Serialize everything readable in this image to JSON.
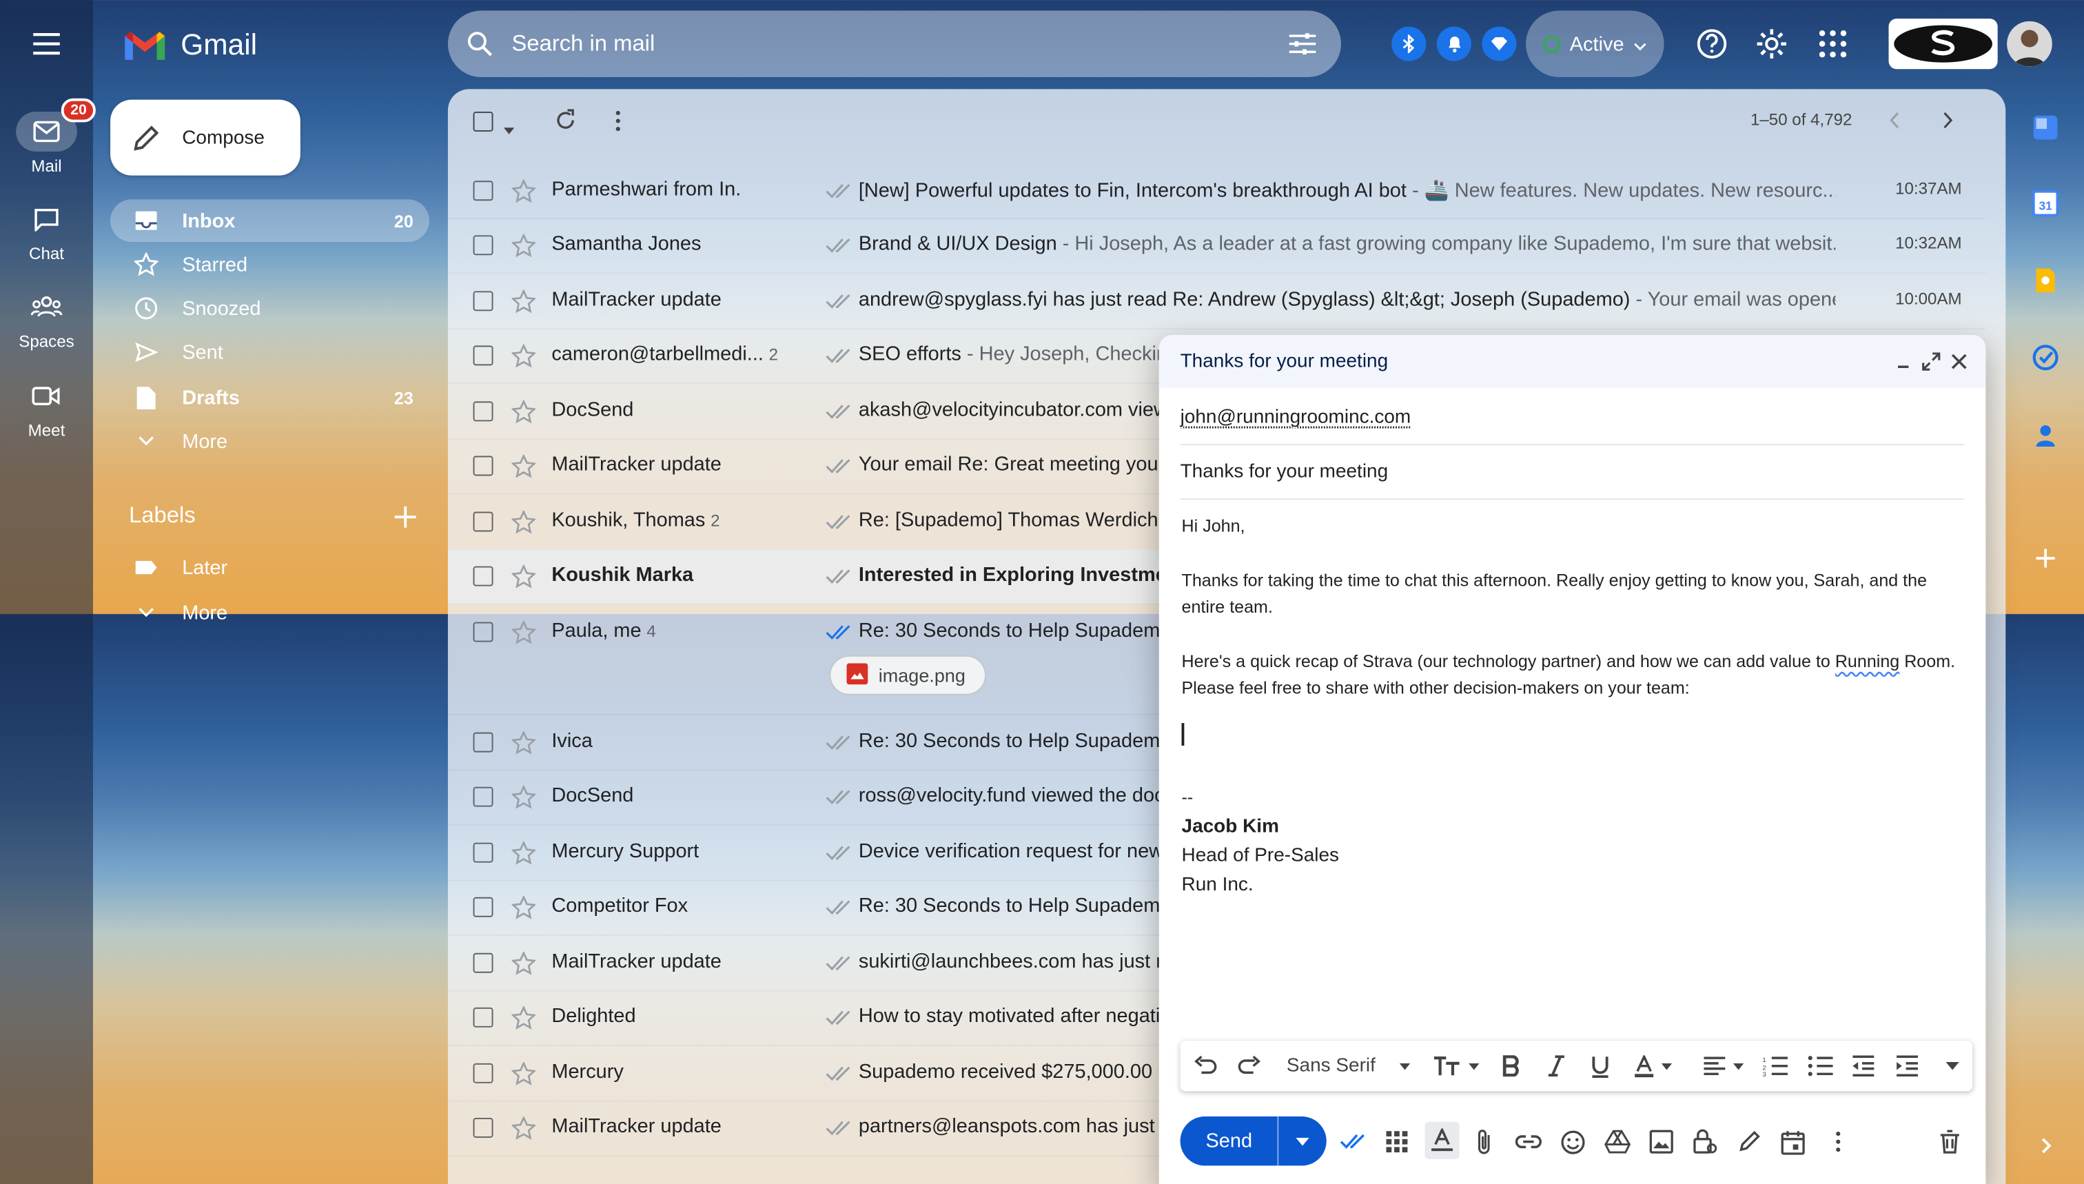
{
  "app": {
    "name": "Gmail"
  },
  "rail": [
    {
      "label": "Mail",
      "badge": "20",
      "icon": "mail-icon"
    },
    {
      "label": "Chat",
      "icon": "chat-icon"
    },
    {
      "label": "Spaces",
      "icon": "spaces-icon"
    },
    {
      "label": "Meet",
      "icon": "meet-icon"
    }
  ],
  "search": {
    "placeholder": "Search in mail"
  },
  "status": {
    "label": "Active",
    "color": "#34a853"
  },
  "sidebar": {
    "compose": "Compose",
    "items": [
      {
        "label": "Inbox",
        "count": "20"
      },
      {
        "label": "Starred",
        "count": ""
      },
      {
        "label": "Snoozed",
        "count": ""
      },
      {
        "label": "Sent",
        "count": ""
      },
      {
        "label": "Drafts",
        "count": "23"
      },
      {
        "label": "More",
        "count": ""
      }
    ],
    "labels_title": "Labels",
    "labels": [
      {
        "label": "Later"
      },
      {
        "label": "More"
      }
    ]
  },
  "list": {
    "pagination": "1–50 of 4,792",
    "rows": [
      {
        "sender": "Parmeshwari from In.",
        "count": "",
        "subject": "[New] Powerful updates to Fin, Intercom's breakthrough AI bot",
        "snippet": " - 🚢 New features. New updates. New resourc...",
        "time": "10:37AM",
        "unread": false
      },
      {
        "sender": "Samantha Jones",
        "count": "",
        "subject": "Brand & UI/UX Design",
        "snippet": " - Hi Joseph, As a leader at a fast growing company like Supademo, I'm sure that websit...",
        "time": "10:32AM",
        "unread": false
      },
      {
        "sender": "MailTracker update",
        "count": "",
        "subject": "andrew@spyglass.fyi has just read Re: Andrew (Spyglass) &lt;&gt; Joseph (Supademo)",
        "snippet": " - Your email was opene...",
        "time": "10:00AM",
        "unread": false
      },
      {
        "sender": "cameron@tarbellmedi...",
        "count": "2",
        "subject": "SEO efforts",
        "snippet": " - Hey Joseph, Checkin",
        "time": "",
        "unread": false
      },
      {
        "sender": "DocSend",
        "count": "",
        "subject": "akash@velocityincubator.com view",
        "snippet": "",
        "time": "",
        "unread": false
      },
      {
        "sender": "MailTracker update",
        "count": "",
        "subject": "Your email Re: Great meeting you i",
        "snippet": "",
        "time": "",
        "unread": false
      },
      {
        "sender": "Koushik, Thomas",
        "count": "2",
        "subject": "Re: [Supademo] Thomas Werdich:",
        "snippet": "",
        "time": "",
        "unread": false
      },
      {
        "sender": "Koushik Marka",
        "count": "",
        "subject": "Interested in Exploring Investme",
        "snippet": "",
        "time": "",
        "unread": true
      },
      {
        "sender": "Paula, me",
        "count": "4",
        "subject": "Re: 30 Seconds to Help Supademo",
        "snippet": "",
        "time": "",
        "unread": false
      },
      {
        "sender": "Ivica",
        "count": "",
        "subject": "Re: 30 Seconds to Help Supademo",
        "snippet": "",
        "time": "",
        "unread": false
      },
      {
        "sender": "DocSend",
        "count": "",
        "subject": "ross@velocity.fund viewed the doc",
        "snippet": "",
        "time": "",
        "unread": false
      },
      {
        "sender": "Mercury Support",
        "count": "",
        "subject": "Device verification request for new",
        "snippet": "",
        "time": "",
        "unread": false
      },
      {
        "sender": "Competitor Fox",
        "count": "",
        "subject": "Re: 30 Seconds to Help Supademo",
        "snippet": "",
        "time": "",
        "unread": false
      },
      {
        "sender": "MailTracker update",
        "count": "",
        "subject": "sukirti@launchbees.com has just r",
        "snippet": "",
        "time": "",
        "unread": false
      },
      {
        "sender": "Delighted",
        "count": "",
        "subject": "How to stay motivated after negati",
        "snippet": "",
        "time": "",
        "unread": false
      },
      {
        "sender": "Mercury",
        "count": "",
        "subject": "Supademo received $275,000.00",
        "snippet": "",
        "time": "",
        "unread": false
      },
      {
        "sender": "MailTracker update",
        "count": "",
        "subject": "partners@leanspots.com has just r",
        "snippet": "",
        "time": "",
        "unread": false
      }
    ],
    "attachment": "image.png"
  },
  "compose_window": {
    "title": "Thanks for your meeting",
    "to": "john@runningroominc.com",
    "subject": "Thanks for your meeting",
    "greeting": "Hi John,",
    "para1": "Thanks for taking the time to chat this afternoon. Really enjoy getting to know you, Sarah, and the entire team.",
    "para2_a": "Here's a quick recap of Strava (our technology partner) and how we can add value to ",
    "para2_spell": "Running",
    "para2_b": " Room. Please feel free to share with other decision-makers on your team:",
    "sig_sep": "--",
    "sig_name": "Jacob Kim",
    "sig_title": "Head of Pre-Sales",
    "sig_company": "Run Inc.",
    "font": "Sans Serif",
    "send": "Send"
  },
  "colors": {
    "accent": "#0b57d0",
    "badge": "#d93025"
  }
}
